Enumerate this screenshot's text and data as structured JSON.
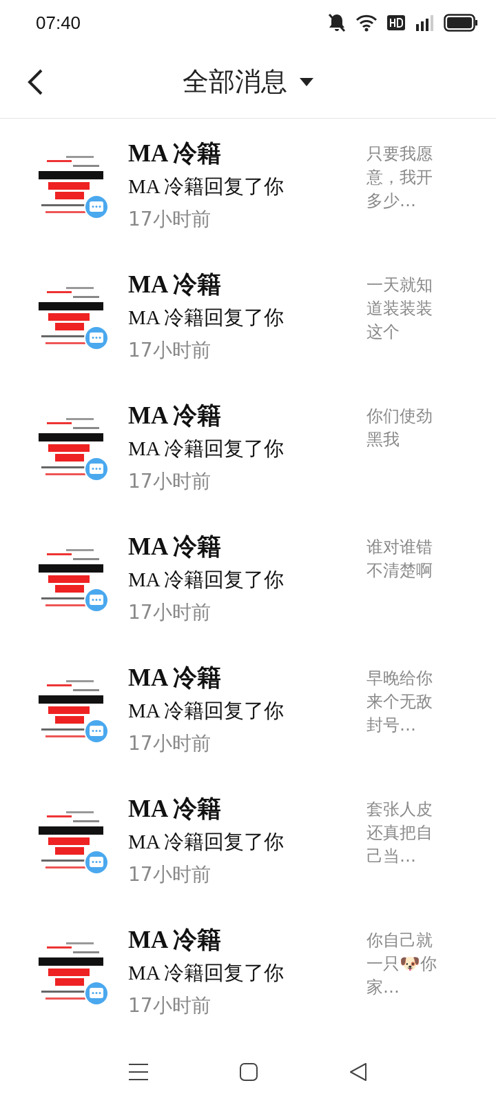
{
  "status_bar": {
    "time": "07:40"
  },
  "header": {
    "title": "全部消息"
  },
  "messages": [
    {
      "name": "MA 冷籍",
      "action": "MA 冷籍回复了你",
      "time": "17小时前",
      "preview": "只要我愿意，我开多少…"
    },
    {
      "name": "MA 冷籍",
      "action": "MA 冷籍回复了你",
      "time": "17小时前",
      "preview": "一天就知道装装装这个"
    },
    {
      "name": "MA 冷籍",
      "action": "MA 冷籍回复了你",
      "time": "17小时前",
      "preview": "你们使劲黑我"
    },
    {
      "name": "MA 冷籍",
      "action": "MA 冷籍回复了你",
      "time": "17小时前",
      "preview": "谁对谁错不清楚啊"
    },
    {
      "name": "MA 冷籍",
      "action": "MA 冷籍回复了你",
      "time": "17小时前",
      "preview": "早晚给你来个无敌封号…"
    },
    {
      "name": "MA 冷籍",
      "action": "MA 冷籍回复了你",
      "time": "17小时前",
      "preview": "套张人皮还真把自己当…"
    },
    {
      "name": "MA 冷籍",
      "action": "MA 冷籍回复了你",
      "time": "17小时前",
      "preview": "你自己就一只🐶你家…"
    }
  ]
}
